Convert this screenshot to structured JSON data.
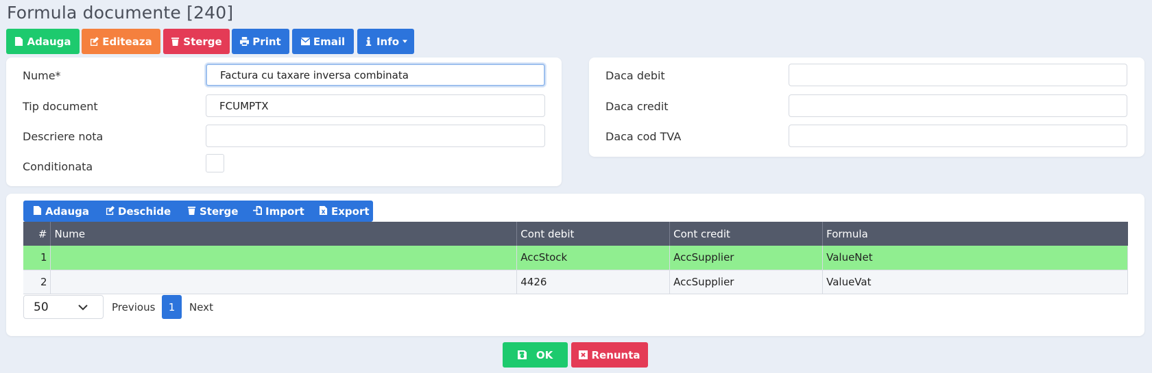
{
  "page": {
    "title": "Formula documente [240]"
  },
  "toolbar": {
    "add": "Adauga",
    "edit": "Editeaza",
    "delete": "Sterge",
    "print": "Print",
    "email": "Email",
    "info": "Info"
  },
  "form": {
    "name_label": "Nume*",
    "name_value": "Factura cu taxare inversa combinata",
    "doc_type_label": "Tip document",
    "doc_type_value": "FCUMPTX",
    "note_label": "Descriere nota",
    "note_value": "",
    "conditional_label": "Conditionata",
    "conditional_checked": false,
    "if_debit_label": "Daca debit",
    "if_debit_value": "",
    "if_credit_label": "Daca credit",
    "if_credit_value": "",
    "if_vat_label": "Daca cod TVA",
    "if_vat_value": ""
  },
  "grid_toolbar": {
    "add": "Adauga",
    "open": "Deschide",
    "delete": "Sterge",
    "import": "Import",
    "export": "Export"
  },
  "grid": {
    "columns": [
      "#",
      "Nume",
      "Cont debit",
      "Cont credit",
      "Formula"
    ],
    "rows": [
      {
        "num": "1",
        "name": "",
        "debit": "AccStock",
        "credit": "AccSupplier",
        "formula": "ValueNet",
        "selected": true
      },
      {
        "num": "2",
        "name": "",
        "debit": "4426",
        "credit": "AccSupplier",
        "formula": "ValueVat",
        "selected": false
      }
    ]
  },
  "pagination": {
    "page_size": "50",
    "previous": "Previous",
    "current": "1",
    "next": "Next"
  },
  "footer": {
    "ok": "OK",
    "cancel": "Renunta"
  },
  "colors": {
    "green": "#1dca6e",
    "orange": "#f5803e",
    "red": "#e43b56",
    "blue": "#2c74dc",
    "header": "#535a6a",
    "selected_row": "#90ee90"
  }
}
